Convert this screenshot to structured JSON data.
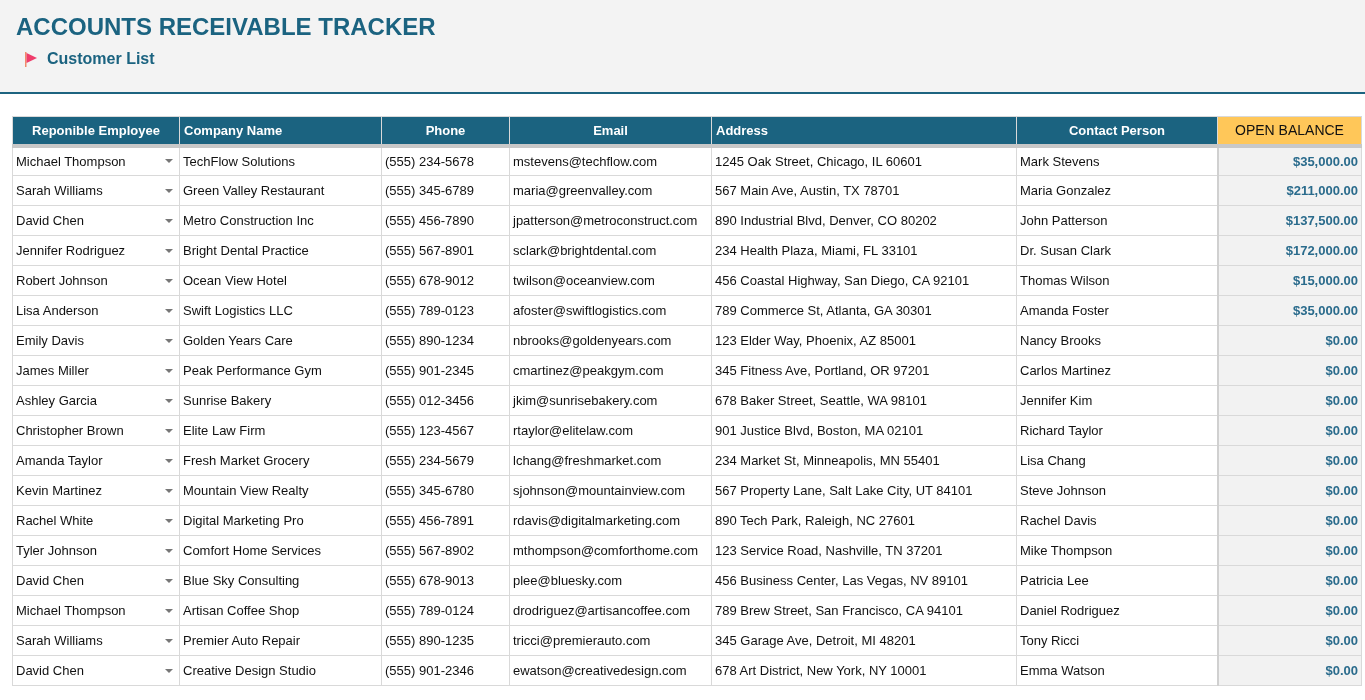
{
  "title": "ACCOUNTS RECEIVABLE TRACKER",
  "subtitle": "Customer List",
  "table": {
    "columns": [
      {
        "label": "Reponible Employee",
        "kind": "plain"
      },
      {
        "label": "Company Name",
        "kind": "plain"
      },
      {
        "label": "Phone",
        "kind": "plain"
      },
      {
        "label": "Email",
        "kind": "plain"
      },
      {
        "label": "Address",
        "kind": "plain"
      },
      {
        "label": "Contact Person",
        "kind": "plain"
      },
      {
        "label": "OPEN BALANCE",
        "kind": "highlight"
      }
    ],
    "rows": [
      [
        "Michael Thompson",
        "TechFlow Solutions",
        "(555) 234-5678",
        "mstevens@techflow.com",
        "1245 Oak Street, Chicago, IL 60601",
        "Mark Stevens",
        "$35,000.00"
      ],
      [
        "Sarah Williams",
        "Green Valley Restaurant",
        "(555) 345-6789",
        "maria@greenvalley.com",
        "567 Main Ave, Austin, TX 78701",
        "Maria Gonzalez",
        "$211,000.00"
      ],
      [
        "David Chen",
        "Metro Construction Inc",
        "(555) 456-7890",
        "jpatterson@metroconstruct.com",
        "890 Industrial Blvd, Denver, CO 80202",
        "John Patterson",
        "$137,500.00"
      ],
      [
        "Jennifer Rodriguez",
        "Bright Dental Practice",
        "(555) 567-8901",
        "sclark@brightdental.com",
        "234 Health Plaza, Miami, FL 33101",
        "Dr. Susan Clark",
        "$172,000.00"
      ],
      [
        "Robert Johnson",
        "Ocean View Hotel",
        "(555) 678-9012",
        "twilson@oceanview.com",
        "456 Coastal Highway, San Diego, CA 92101",
        "Thomas Wilson",
        "$15,000.00"
      ],
      [
        "Lisa Anderson",
        "Swift Logistics LLC",
        "(555) 789-0123",
        "afoster@swiftlogistics.com",
        "789 Commerce St, Atlanta, GA 30301",
        "Amanda Foster",
        "$35,000.00"
      ],
      [
        "Emily Davis",
        "Golden Years Care",
        "(555) 890-1234",
        "nbrooks@goldenyears.com",
        "123 Elder Way, Phoenix, AZ 85001",
        "Nancy Brooks",
        "$0.00"
      ],
      [
        "James Miller",
        "Peak Performance Gym",
        "(555) 901-2345",
        "cmartinez@peakgym.com",
        "345 Fitness Ave, Portland, OR 97201",
        "Carlos Martinez",
        "$0.00"
      ],
      [
        "Ashley Garcia",
        "Sunrise Bakery",
        "(555) 012-3456",
        "jkim@sunrisebakery.com",
        "678 Baker Street, Seattle, WA 98101",
        "Jennifer Kim",
        "$0.00"
      ],
      [
        "Christopher Brown",
        "Elite Law Firm",
        "(555) 123-4567",
        "rtaylor@elitelaw.com",
        "901 Justice Blvd, Boston, MA 02101",
        "Richard Taylor",
        "$0.00"
      ],
      [
        "Amanda Taylor",
        "Fresh Market Grocery",
        "(555) 234-5679",
        "lchang@freshmarket.com",
        "234 Market St, Minneapolis, MN 55401",
        "Lisa Chang",
        "$0.00"
      ],
      [
        "Kevin Martinez",
        "Mountain View Realty",
        "(555) 345-6780",
        "sjohnson@mountainview.com",
        "567 Property Lane, Salt Lake City, UT 84101",
        "Steve Johnson",
        "$0.00"
      ],
      [
        "Rachel White",
        "Digital Marketing Pro",
        "(555) 456-7891",
        "rdavis@digitalmarketing.com",
        "890 Tech Park, Raleigh, NC 27601",
        "Rachel Davis",
        "$0.00"
      ],
      [
        "Tyler Johnson",
        "Comfort Home Services",
        "(555) 567-8902",
        "mthompson@comforthome.com",
        "123 Service Road, Nashville, TN 37201",
        "Mike Thompson",
        "$0.00"
      ],
      [
        "David Chen",
        "Blue Sky Consulting",
        "(555) 678-9013",
        "plee@bluesky.com",
        "456 Business Center, Las Vegas, NV 89101",
        "Patricia Lee",
        "$0.00"
      ],
      [
        "Michael Thompson",
        "Artisan Coffee Shop",
        "(555) 789-0124",
        "drodriguez@artisancoffee.com",
        "789 Brew Street, San Francisco, CA 94101",
        "Daniel Rodriguez",
        "$0.00"
      ],
      [
        "Sarah Williams",
        "Premier Auto Repair",
        "(555) 890-1235",
        "tricci@premierauto.com",
        "345 Garage Ave, Detroit, MI 48201",
        "Tony Ricci",
        "$0.00"
      ],
      [
        "David Chen",
        "Creative Design Studio",
        "(555) 901-2346",
        "ewatson@creativedesign.com",
        "678 Art District, New York, NY 10001",
        "Emma Watson",
        "$0.00"
      ]
    ]
  }
}
